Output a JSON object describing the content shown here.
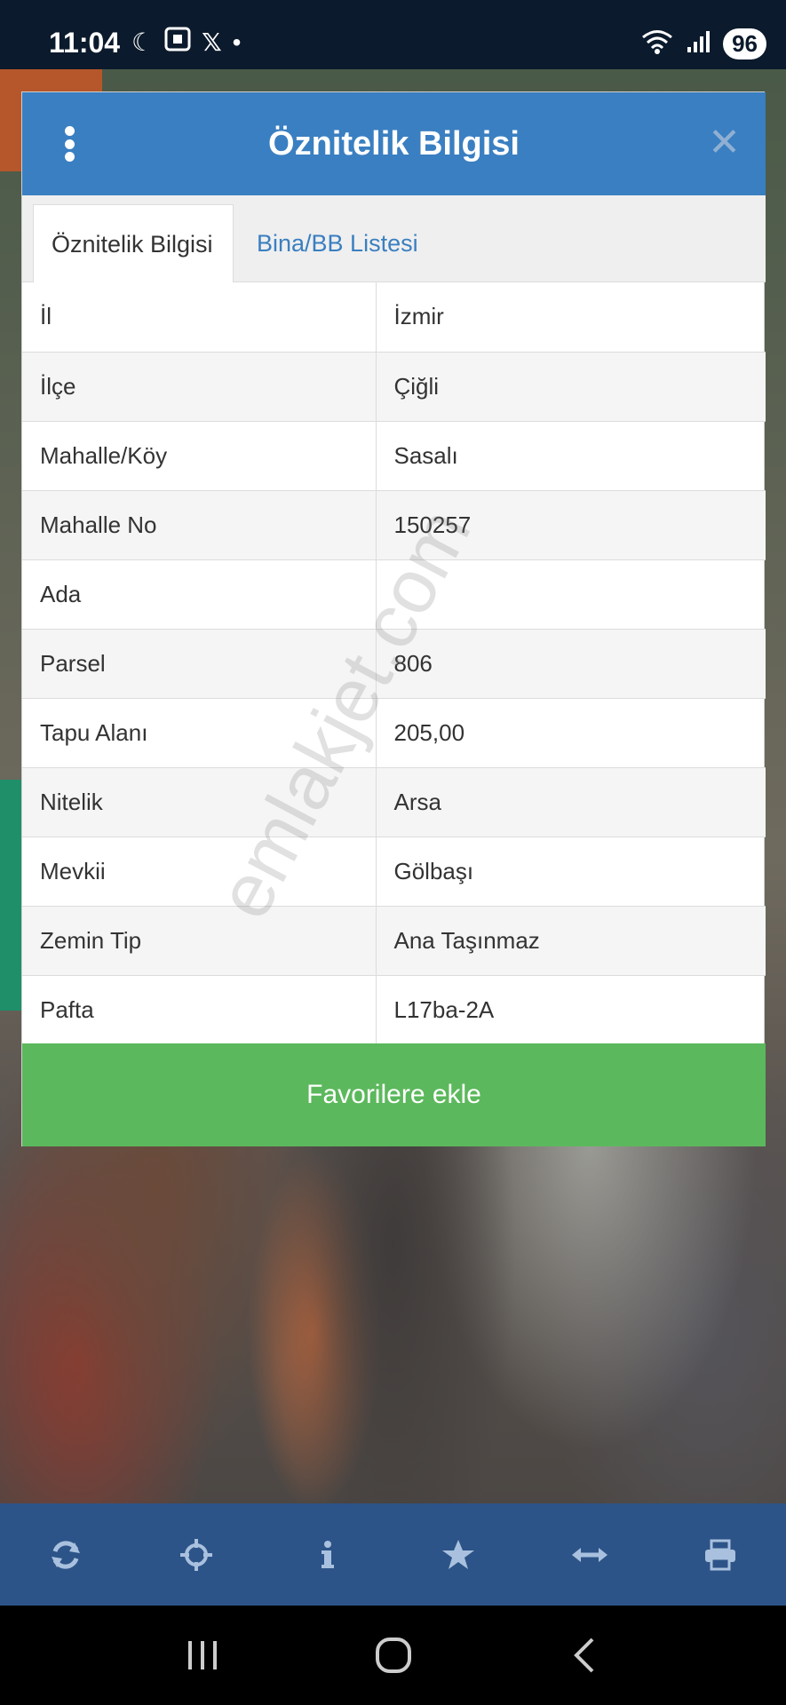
{
  "status_bar": {
    "time": "11:04",
    "battery": "96"
  },
  "dialog": {
    "title": "Öznitelik Bilgisi",
    "tabs": [
      {
        "label": "Öznitelik Bilgisi",
        "active": true
      },
      {
        "label": "Bina/BB Listesi",
        "active": false
      }
    ],
    "rows": [
      {
        "key": "İl",
        "value": "İzmir"
      },
      {
        "key": "İlçe",
        "value": "Çiğli"
      },
      {
        "key": "Mahalle/Köy",
        "value": "Sasalı"
      },
      {
        "key": "Mahalle No",
        "value": "150257"
      },
      {
        "key": "Ada",
        "value": ""
      },
      {
        "key": "Parsel",
        "value": "806"
      },
      {
        "key": "Tapu Alanı",
        "value": "205,00"
      },
      {
        "key": "Nitelik",
        "value": "Arsa"
      },
      {
        "key": "Mevkii",
        "value": "Gölbaşı"
      },
      {
        "key": "Zemin Tip",
        "value": "Ana Taşınmaz"
      },
      {
        "key": "Pafta",
        "value": "L17ba-2A"
      }
    ],
    "favorite_button": "Favorilere ekle"
  },
  "watermark": "emlakjet.com",
  "toolbar": {
    "icons": [
      "refresh-icon",
      "crosshair-icon",
      "info-icon",
      "star-icon",
      "measure-icon",
      "print-icon"
    ]
  },
  "colors": {
    "header": "#3a7fc1",
    "favorite": "#5cb85c",
    "toolbar": "#2d5488"
  }
}
